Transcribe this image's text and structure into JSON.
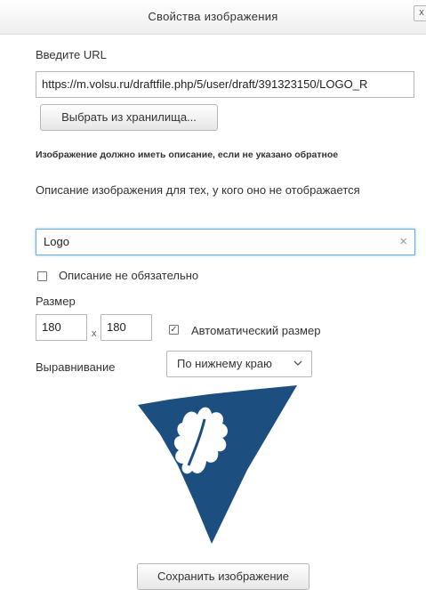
{
  "dialog": {
    "title": "Свойства изображения",
    "close_label": "x"
  },
  "url": {
    "label": "Введите URL",
    "value": "https://m.volsu.ru/draftfile.php/5/user/draft/391323150/LOGO_R"
  },
  "browse_button": "Выбрать из хранилища...",
  "warning": "Изображение должно иметь описание, если не указано обратное",
  "alt": {
    "label": "Описание изображения для тех, у кого оно не отображается",
    "value": "Logo",
    "clear_icon": "×"
  },
  "decorative": {
    "label": "Описание не обязательно",
    "checked": false
  },
  "size": {
    "label": "Размер",
    "width": "180",
    "separator": "x",
    "height": "180",
    "auto_label": "Автоматический размер",
    "auto_checked": true,
    "check_glyph": "✓"
  },
  "alignment": {
    "label": "Выравнивание",
    "selected": "По нижнему краю"
  },
  "preview": {
    "logo_color": "#1c4f7f"
  },
  "save_button": "Сохранить изображение"
}
